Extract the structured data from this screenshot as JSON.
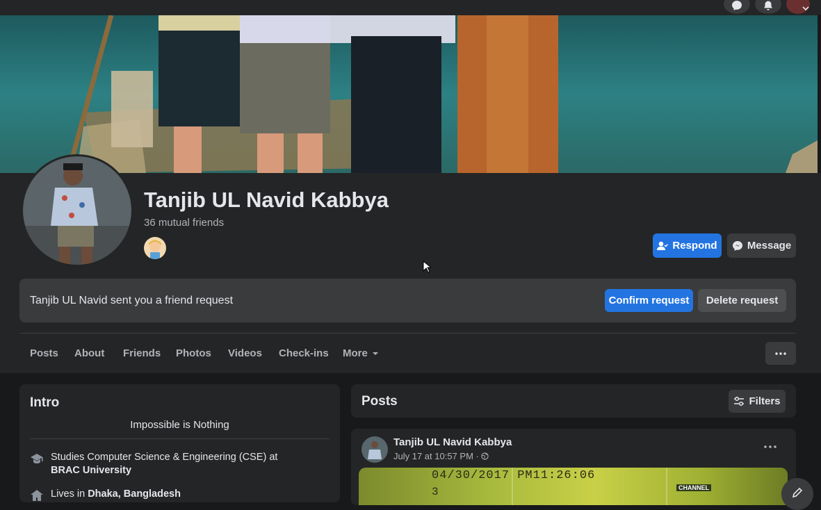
{
  "profile": {
    "name": "Tanjib UL Navid Kabbya",
    "mutual_friends": "36 mutual friends"
  },
  "actions": {
    "respond_label": "Respond",
    "message_label": "Message"
  },
  "friend_request": {
    "text": "Tanjib UL Navid sent you a friend request",
    "confirm_label": "Confirm request",
    "delete_label": "Delete request"
  },
  "tabs": [
    {
      "label": "Posts"
    },
    {
      "label": "About"
    },
    {
      "label": "Friends"
    },
    {
      "label": "Photos"
    },
    {
      "label": "Videos"
    },
    {
      "label": "Check-ins"
    },
    {
      "label": "More"
    }
  ],
  "intro": {
    "title": "Intro",
    "bio": "Impossible is Nothing",
    "studies_prefix": "Studies Computer Science & Engineering (CSE) at ",
    "studies_school": "BRAC University",
    "lives_prefix": "Lives in ",
    "lives_place": "Dhaka, Bangladesh"
  },
  "posts": {
    "title": "Posts",
    "filters_label": "Filters",
    "first_post": {
      "author": "Tanjib UL Navid Kabbya",
      "time": "July 17 at 10:57 PM ·",
      "video_timestamp": "04/30/2017 PM11:26:06",
      "video_counter": "3",
      "channel_badge": "CHANNEL"
    }
  },
  "colors": {
    "background": "#18191a",
    "card": "#242526",
    "button_gray": "#3a3b3c",
    "accent_blue": "#2374e1",
    "text_primary": "#e4e6eb",
    "text_secondary": "#b0b3b8"
  }
}
